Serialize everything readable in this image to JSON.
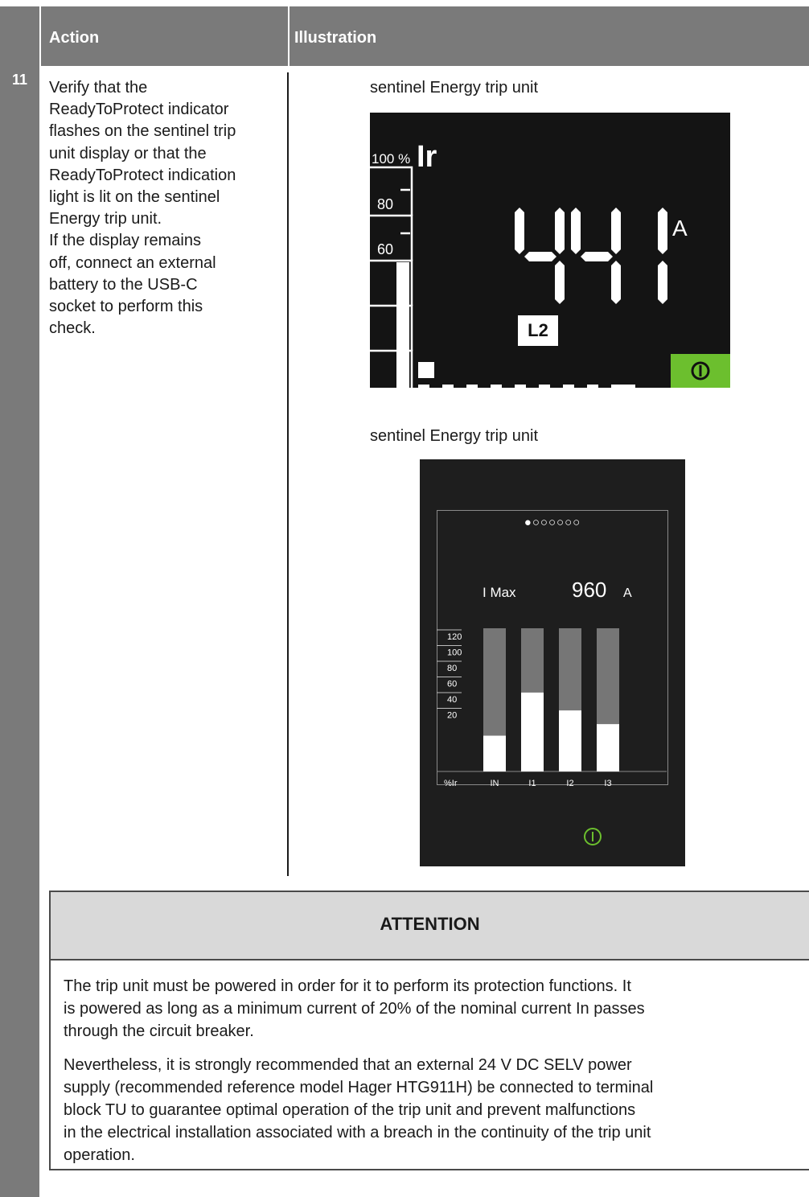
{
  "table": {
    "header": {
      "action": "Action",
      "illustration": "Illustration"
    },
    "step": {
      "number": "11",
      "action_lines": [
        "Verify that the",
        "ReadyToProtect indicator",
        "flashes on the sentinel trip",
        "unit display or that the",
        "ReadyToProtect indication",
        "light is lit on the sentinel",
        "Energy trip unit.",
        "If the display remains",
        "off, connect an external",
        "battery to the USB-C",
        "socket to perform this",
        "check."
      ]
    }
  },
  "illustrations": {
    "caption1": "sentinel Energy trip unit",
    "caption2": "sentinel Energy trip unit",
    "display1": {
      "scale_top": "100 %",
      "param": "Ir",
      "scale_80": "80",
      "scale_60": "60",
      "value": "441",
      "unit": "A",
      "phase": "L2",
      "ready_color": "#6cbf2e",
      "icon": "power-icon"
    },
    "display2": {
      "page_dots": "●○○○○○○",
      "label": "I Max",
      "value": "960",
      "unit": "A",
      "ready_color": "#6cbf2e",
      "icon": "power-icon"
    }
  },
  "chart_data": {
    "type": "bar",
    "categories": [
      "IN",
      "I1",
      "I2",
      "I3"
    ],
    "values": [
      34,
      75,
      58,
      45
    ],
    "ylabel": "%Ir",
    "yticks": [
      "120",
      "100",
      "80",
      "60",
      "40",
      "20"
    ],
    "ylim": [
      0,
      130
    ]
  },
  "attention": {
    "title": "ATTENTION",
    "p1_lines": [
      "The trip unit must be powered in order for it to perform its protection functions. It",
      "is powered as long as a minimum current of 20% of the nominal current In passes",
      "through the circuit breaker."
    ],
    "p2_lines": [
      "Nevertheless, it is strongly recommended that an external 24 V DC SELV power",
      "supply (recommended reference model Hager HTG911H) be connected to terminal",
      "block TU to guarantee optimal operation of the trip unit and prevent malfunctions",
      "in the electrical installation associated with a breach in the continuity of the trip unit",
      "operation."
    ]
  }
}
